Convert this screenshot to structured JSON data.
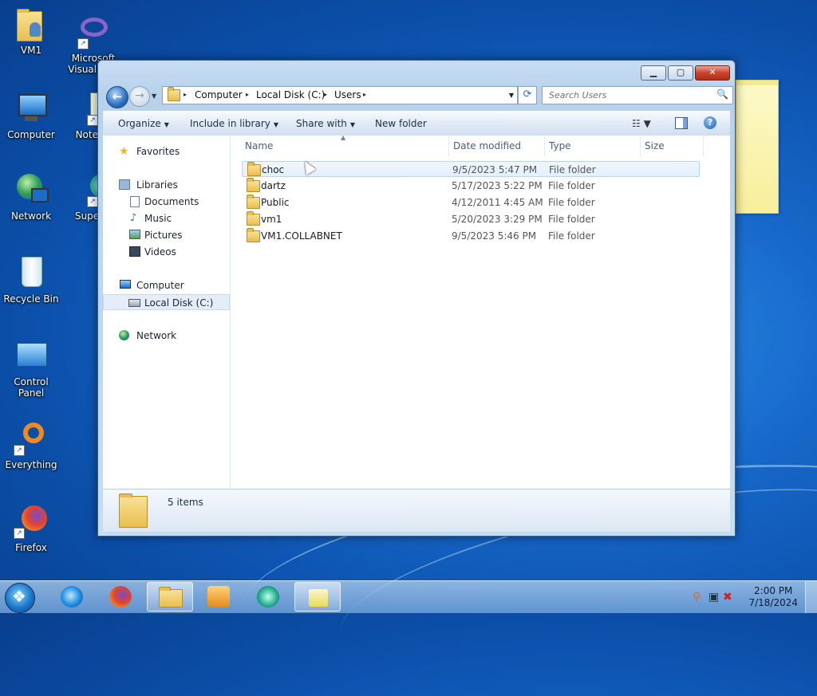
{
  "desktop": {
    "icons": [
      {
        "label": "VM1"
      },
      {
        "label": "Microsoft Visual St..."
      },
      {
        "label": "Computer"
      },
      {
        "label": "Notepa..."
      },
      {
        "label": "Network"
      },
      {
        "label": "Superm..."
      },
      {
        "label": "Recycle Bin"
      },
      {
        "label": "Control Panel"
      },
      {
        "label": "Everything"
      },
      {
        "label": "Firefox"
      }
    ]
  },
  "window": {
    "caption_buttons": {
      "minimize": "▁",
      "maximize": "▢",
      "close": "✕"
    },
    "nav": {
      "back": "←",
      "forward": "→",
      "dropdown": "▼"
    },
    "address": {
      "crumbs": [
        "Computer",
        "Local Disk (C:)",
        "Users"
      ],
      "separator": "▸",
      "dropdown": "▼",
      "refresh": "⟳"
    },
    "search": {
      "placeholder": "Search Users",
      "icon": "🔍"
    },
    "toolbar": {
      "organize": "Organize",
      "include_in_library": "Include in library",
      "share_with": "Share with",
      "new_folder": "New folder",
      "dropdown_arrow": "▼",
      "view_icon": "☷ ▼",
      "help": "?"
    },
    "nav_pane": {
      "favorites": "Favorites",
      "libraries": "Libraries",
      "documents": "Documents",
      "music": "Music",
      "pictures": "Pictures",
      "videos": "Videos",
      "computer": "Computer",
      "local_disk": "Local Disk (C:)",
      "network": "Network"
    },
    "columns": {
      "name": "Name",
      "date_modified": "Date modified",
      "type": "Type",
      "size": "Size",
      "sort_arrow": "▲"
    },
    "files": [
      {
        "name": "choc",
        "date": "9/5/2023 5:47 PM",
        "type": "File folder"
      },
      {
        "name": "dartz",
        "date": "5/17/2023 5:22 PM",
        "type": "File folder"
      },
      {
        "name": "Public",
        "date": "4/12/2011 4:45 AM",
        "type": "File folder"
      },
      {
        "name": "vm1",
        "date": "5/20/2023 3:29 PM",
        "type": "File folder"
      },
      {
        "name": "VM1.COLLABNET",
        "date": "9/5/2023 5:46 PM",
        "type": "File folder"
      }
    ],
    "status": {
      "count": "5 items"
    }
  },
  "taskbar": {
    "clock_time": "2:00 PM",
    "clock_date": "7/18/2024"
  },
  "colors": {
    "accent": "#1d5fb5",
    "selection": "#e2effd"
  }
}
